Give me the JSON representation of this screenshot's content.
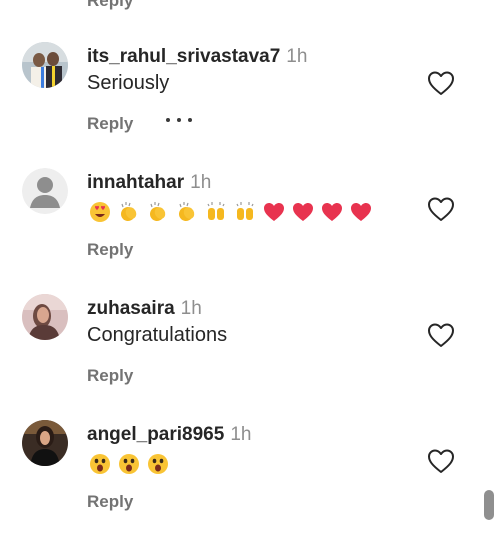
{
  "top_reply_label": "Reply",
  "comments": [
    {
      "username": "its_rahul_srivastava7",
      "time": "1h",
      "text": "Seriously",
      "emojis": [],
      "reply_label": "Reply",
      "has_more": true,
      "avatar": "photo-avatar"
    },
    {
      "username": "innahtahar",
      "time": "1h",
      "text": "",
      "emojis": [
        "heart-eyes-emoji",
        "clapping-hands-emoji",
        "clapping-hands-emoji",
        "clapping-hands-emoji",
        "raising-hands-emoji",
        "raising-hands-emoji",
        "red-heart-emoji",
        "red-heart-emoji",
        "red-heart-emoji",
        "red-heart-emoji"
      ],
      "reply_label": "Reply",
      "has_more": false,
      "avatar": "default-avatar"
    },
    {
      "username": "zuhasaira",
      "time": "1h",
      "text": "Congratulations",
      "emojis": [],
      "reply_label": "Reply",
      "has_more": false,
      "avatar": "photo-avatar"
    },
    {
      "username": "angel_pari8965",
      "time": "1h",
      "text": "",
      "emojis": [
        "astonished-face-emoji",
        "astonished-face-emoji",
        "astonished-face-emoji"
      ],
      "reply_label": "Reply",
      "has_more": false,
      "avatar": "photo-avatar"
    }
  ],
  "icons": {
    "like": "heart-outline-icon",
    "more": "more-options-icon"
  },
  "colors": {
    "text": "#262626",
    "secondary": "#737373",
    "time": "#8e8e8e",
    "heart_red": "#e8334f",
    "emoji_yellow": "#f9c435"
  }
}
